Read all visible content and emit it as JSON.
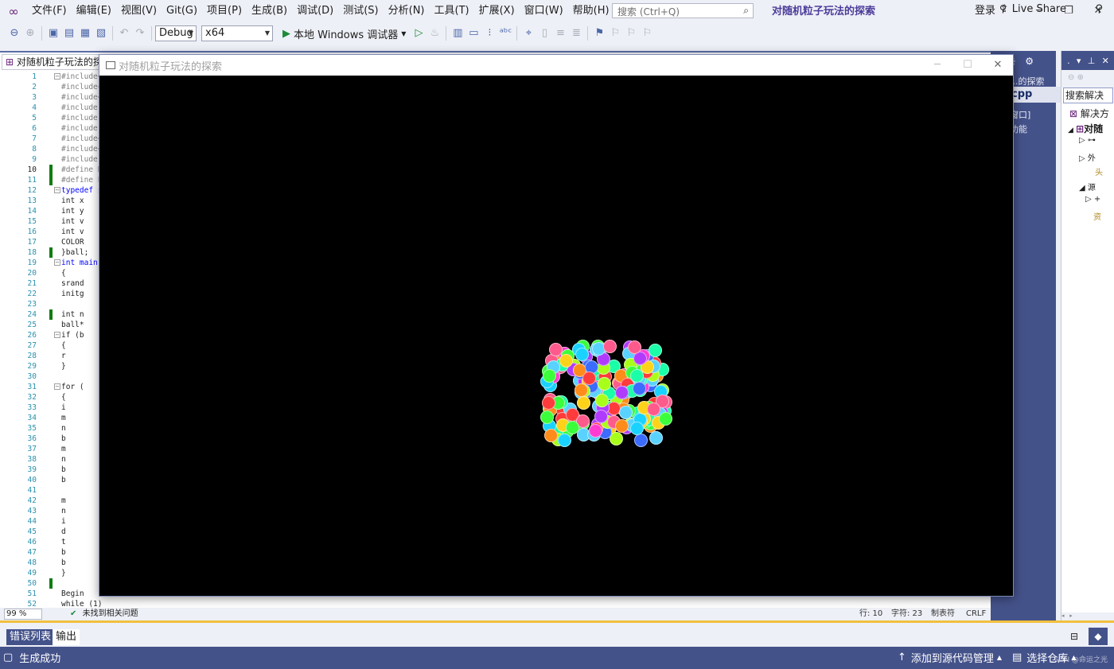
{
  "menubar": {
    "items": [
      "文件(F)",
      "编辑(E)",
      "视图(V)",
      "Git(G)",
      "项目(P)",
      "生成(B)",
      "调试(D)",
      "测试(S)",
      "分析(N)",
      "工具(T)",
      "扩展(X)",
      "窗口(W)",
      "帮助(H)"
    ],
    "search_placeholder": "搜索 (Ctrl+Q)",
    "solution_title": "对随机粒子玩法的探索",
    "login": "登录"
  },
  "toolbar": {
    "config": "Debug",
    "platform": "x64",
    "run_label": "本地 Windows 调试器",
    "live_share": "Live Share"
  },
  "editor": {
    "tab_title": "对随机粒子玩法的探索.cpp",
    "line_numbers": [
      "1",
      "2",
      "3",
      "4",
      "5",
      "6",
      "7",
      "8",
      "9",
      "10",
      "11",
      "12",
      "13",
      "14",
      "15",
      "16",
      "17",
      "18",
      "19",
      "20",
      "21",
      "22",
      "23",
      "24",
      "25",
      "26",
      "27",
      "28",
      "29",
      "30",
      "31",
      "32",
      "33",
      "34",
      "35",
      "36",
      "37",
      "38",
      "39",
      "40",
      "41",
      "42",
      "43",
      "44",
      "45",
      "46",
      "47",
      "48",
      "49",
      "50",
      "51",
      "52"
    ],
    "code_lines": [
      "#include<",
      "#include<",
      "#include<",
      "#include ",
      "#include ",
      "#include ",
      "#include<",
      "#include<",
      "#include ",
      "#define N",
      "#define P",
      "typedef s",
      "    int x",
      "    int y",
      "    int v",
      "    int v",
      "    COLOR",
      "}ball;",
      "int main(",
      "{",
      "    srand",
      "    initg",
      "",
      "    int n",
      "    ball*",
      "    if (b",
      "    {",
      "        r",
      "    }",
      "",
      "    for (",
      "    {",
      "        i",
      "        m",
      "        n",
      "        b",
      "        m",
      "        n",
      "        b",
      "        b",
      "",
      "        m",
      "        n",
      "        i",
      "        d",
      "        t",
      "        b",
      "        b",
      "    }",
      "",
      "    Begin",
      "    while (1)"
    ],
    "zoom": "99 %",
    "issues": "未找到相关问题",
    "row": "行: 10",
    "col": "字符: 23",
    "tabs": "制表符",
    "eol": "CRLF"
  },
  "graphics_window": {
    "title": "对随机粒子玩法的探索",
    "particle_colors": [
      "#ff3b3b",
      "#ff8c1a",
      "#ffd21a",
      "#3bff3b",
      "#1ad2ff",
      "#3b6bff",
      "#b03bff",
      "#ff3bd2",
      "#1affa8",
      "#a8ff1a",
      "#ff5a8c",
      "#5ad2ff"
    ]
  },
  "left_strip": {
    "header": "卡",
    "items": [
      "...的探索",
      "窗口]",
      "功能"
    ],
    "file": "cpp"
  },
  "solution_explorer": {
    "search_placeholder": "搜索解决",
    "rows": [
      "解决方",
      "对随",
      "▷ ⊶",
      "▷ 外",
      "  头",
      "◢ 源",
      "  ▷ +",
      "  资"
    ]
  },
  "bottom": {
    "tab_errors": "错误列表",
    "tab_output": "输出",
    "status": "生成成功",
    "add_source": "添加到源代码管理",
    "select_repo": "选择仓库",
    "watermark": "CSDN @命运之光"
  }
}
